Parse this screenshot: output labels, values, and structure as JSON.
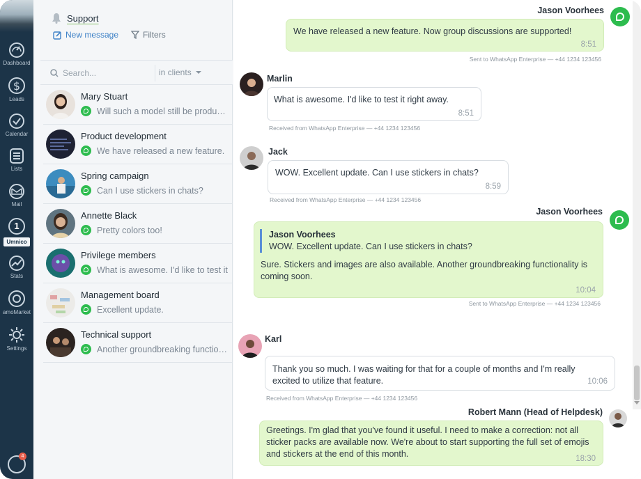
{
  "nav": {
    "items": [
      {
        "label": "Dashboard",
        "icon": "dashboard-icon"
      },
      {
        "label": "Leads",
        "icon": "dollar-icon"
      },
      {
        "label": "Calendar",
        "icon": "check-icon"
      },
      {
        "label": "Lists",
        "icon": "list-icon"
      },
      {
        "label": "Mail",
        "icon": "mail-icon"
      },
      {
        "label": "Umnico",
        "icon": "umnico-icon",
        "number": "1"
      },
      {
        "label": "Stats",
        "icon": "stats-icon"
      },
      {
        "label": "amoMarket",
        "icon": "market-icon"
      },
      {
        "label": "Settings",
        "icon": "gear-icon"
      }
    ],
    "chat_badge": "4"
  },
  "sidebar": {
    "title": "Support",
    "new_message": "New message",
    "filters": "Filters",
    "search_placeholder": "Search...",
    "scope": "in clients"
  },
  "conversations": [
    {
      "name": "Mary Stuart",
      "preview": "Will such a model still be produced?",
      "channel": "whatsapp"
    },
    {
      "name": "Product development",
      "preview": "We have released a new feature.",
      "channel": "whatsapp"
    },
    {
      "name": "Spring campaign",
      "preview": "Can I use stickers in chats?",
      "channel": "whatsapp"
    },
    {
      "name": "Annette Black",
      "preview": "Pretty colors too!",
      "channel": "whatsapp"
    },
    {
      "name": "Privilege members",
      "preview": "What is awesome. I'd like to test it",
      "channel": "whatsapp"
    },
    {
      "name": "Management board",
      "preview": "Excellent update.",
      "channel": "whatsapp"
    },
    {
      "name": "Technical support",
      "preview": "Another groundbreaking functionality",
      "channel": "whatsapp"
    }
  ],
  "messages": [
    {
      "sender": "Jason Voorhees",
      "text": "We have released a new feature. Now group discussions are supported!",
      "time": "8:51",
      "meta": "Sent to WhatsApp Enterprise — +44 1234 123456",
      "direction": "out"
    },
    {
      "sender": "Marlin",
      "text": "What is awesome. I'd like to test it right away.",
      "time": "8:51",
      "meta": "Received from WhatsApp Enterprise — +44 1234 123456",
      "direction": "in"
    },
    {
      "sender": "Jack",
      "text": "WOW. Excellent update. Can I use stickers in chats?",
      "time": "8:59",
      "meta": "Received from WhatsApp Enterprise — +44 1234 123456",
      "direction": "in"
    },
    {
      "sender": "Jason Voorhees",
      "quote_name": "Jason Voorhees",
      "quote_text": "WOW. Excellent update. Can I use stickers in chats?",
      "text": "Sure. Stickers and images are also available. Another groundbreaking functionality is coming soon.",
      "time": "10:04",
      "meta": "Sent to WhatsApp Enterprise — +44 1234 123456",
      "direction": "out"
    },
    {
      "sender": "Karl",
      "text": "Thank you so much. I was waiting for that for a couple of months and I'm really excited to utilize that feature.",
      "time": "10:06",
      "meta": "Received from WhatsApp Enterprise — +44 1234 123456",
      "direction": "in"
    },
    {
      "sender": "Robert Mann (Head of Helpdesk)",
      "text": "Greetings. I'm glad that you've found it useful. I need to make a correction: not all sticker packs are available now. We're about to start supporting the full set of emojis and stickers at the end of this month.",
      "time": "18:30",
      "direction": "out"
    }
  ],
  "colors": {
    "nav_bg": "#1c3448",
    "accent_blue": "#3f82c7",
    "whatsapp_green": "#2dbc4e",
    "outgoing_bubble": "#e3f7cd"
  }
}
